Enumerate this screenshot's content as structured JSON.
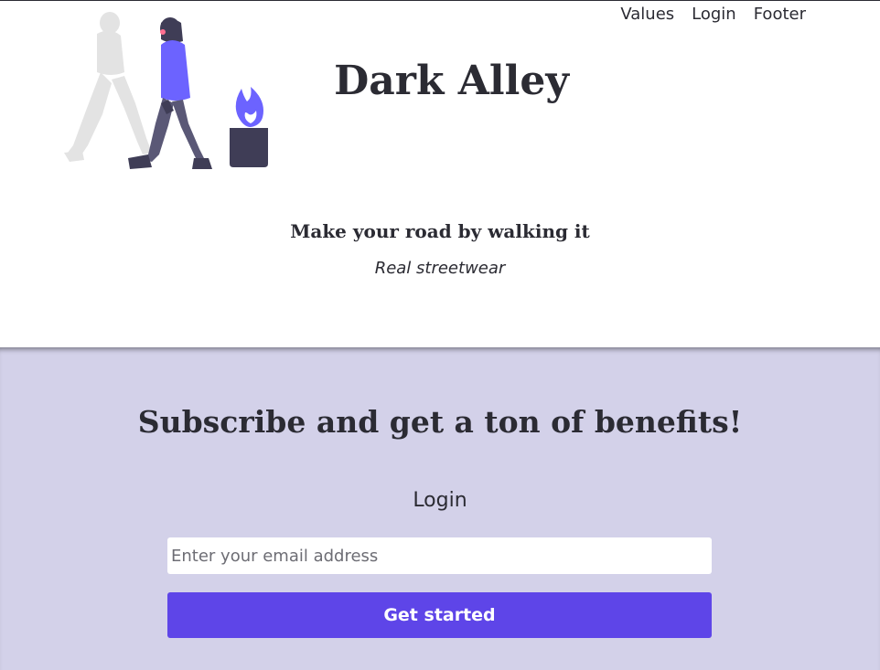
{
  "nav": {
    "items": [
      "Values",
      "Login",
      "Footer"
    ]
  },
  "hero": {
    "title": "Dark Alley",
    "tagline": "Make your road by walking it",
    "subtagline": "Real streetwear"
  },
  "subscribe": {
    "heading": "Subscribe and get a ton of benefits!",
    "login_label": "Login",
    "email_placeholder": "Enter your email address",
    "button_label": "Get started"
  },
  "colors": {
    "accent": "#5e45e8",
    "section_bg": "#d3d1e9",
    "text": "#2b2b33",
    "illustration_accent": "#6c63ff"
  },
  "icons": {
    "illustration": "walking-people-fire-illustration"
  }
}
